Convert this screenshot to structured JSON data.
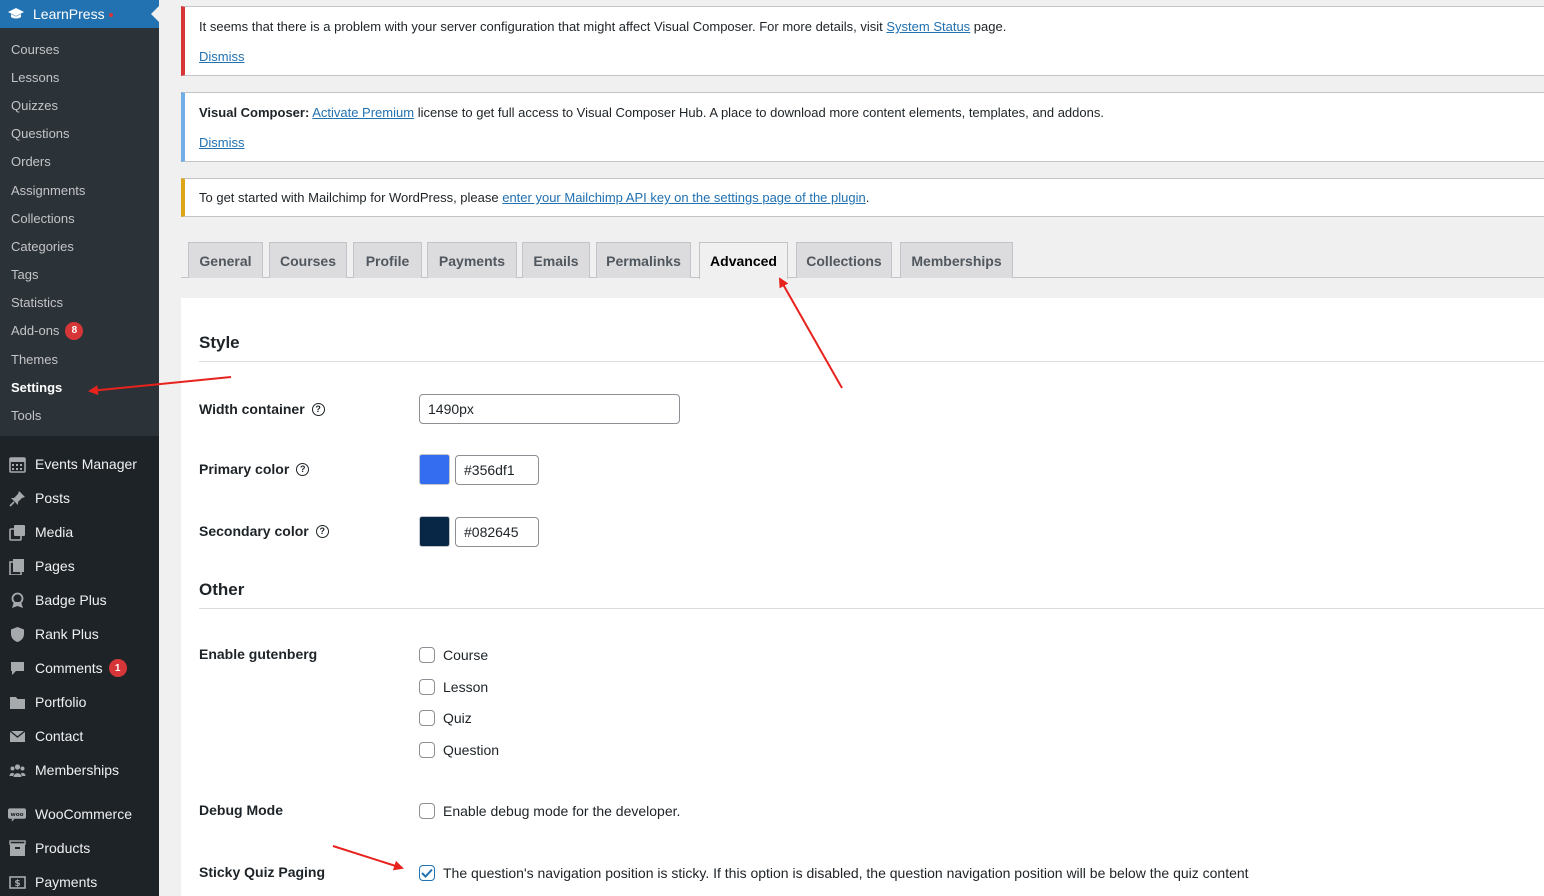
{
  "sidebar": {
    "plugin_title": "LearnPress",
    "submenu": [
      {
        "label": "Courses"
      },
      {
        "label": "Lessons"
      },
      {
        "label": "Quizzes"
      },
      {
        "label": "Questions"
      },
      {
        "label": "Orders"
      },
      {
        "label": "Assignments"
      },
      {
        "label": "Collections"
      },
      {
        "label": "Categories"
      },
      {
        "label": "Tags"
      },
      {
        "label": "Statistics"
      },
      {
        "label": "Add-ons",
        "badge": "8"
      },
      {
        "label": "Themes"
      },
      {
        "label": "Settings",
        "active": true
      },
      {
        "label": "Tools"
      }
    ],
    "menu": [
      {
        "label": "Events Manager",
        "icon": "calendar-icon"
      },
      {
        "label": "Posts",
        "icon": "pin-icon"
      },
      {
        "label": "Media",
        "icon": "media-icon"
      },
      {
        "label": "Pages",
        "icon": "pages-icon"
      },
      {
        "label": "Badge Plus",
        "icon": "badge-icon"
      },
      {
        "label": "Rank Plus",
        "icon": "shield-icon"
      },
      {
        "label": "Comments",
        "icon": "comment-icon",
        "badge": "1"
      },
      {
        "label": "Portfolio",
        "icon": "folder-icon"
      },
      {
        "label": "Contact",
        "icon": "envelope-icon"
      },
      {
        "label": "Memberships",
        "icon": "people-icon"
      },
      {
        "label": "WooCommerce",
        "icon": "woo-icon"
      },
      {
        "label": "Products",
        "icon": "products-icon"
      },
      {
        "label": "Payments",
        "icon": "payments-icon"
      }
    ]
  },
  "notices": {
    "error": {
      "text": "It seems that there is a problem with your server configuration that might affect Visual Composer. For more details, visit ",
      "link": "System Status",
      "after": " page.",
      "dismiss": "Dismiss"
    },
    "info": {
      "strong": "Visual Composer:",
      "link": "Activate Premium",
      "after": " license to get full access to Visual Composer Hub. A place to download more content elements, templates, and addons.",
      "dismiss": "Dismiss"
    },
    "warning": {
      "text": "To get started with Mailchimp for WordPress, please ",
      "link": "enter your Mailchimp API key on the settings page of the plugin",
      "after": "."
    }
  },
  "tabs": [
    "General",
    "Courses",
    "Profile",
    "Payments",
    "Emails",
    "Permalinks",
    "Advanced",
    "Collections",
    "Memberships"
  ],
  "active_tab": "Advanced",
  "style_section": {
    "heading": "Style",
    "width_label": "Width container",
    "width_value": "1490px",
    "primary_label": "Primary color",
    "primary_value": "#356df1",
    "secondary_label": "Secondary color",
    "secondary_value": "#082645"
  },
  "other_section": {
    "heading": "Other",
    "gutenberg_label": "Enable gutenberg",
    "gutenberg_options": [
      {
        "label": "Course",
        "checked": false
      },
      {
        "label": "Lesson",
        "checked": false
      },
      {
        "label": "Quiz",
        "checked": false
      },
      {
        "label": "Question",
        "checked": false
      }
    ],
    "debug_label": "Debug Mode",
    "debug_option": "Enable debug mode for the developer.",
    "sticky_label": "Sticky Quiz Paging",
    "sticky_option": "The question's navigation position is sticky. If this option is disabled, the question navigation position will be below the quiz content",
    "sticky_checked": true
  },
  "help_glyph": "?",
  "colors": {
    "sidebar_bg": "#1d2327",
    "submenu_bg": "#2c3338",
    "accent": "#2271b1",
    "badge": "#d63638",
    "annotation_arrow": "#e8221c"
  }
}
